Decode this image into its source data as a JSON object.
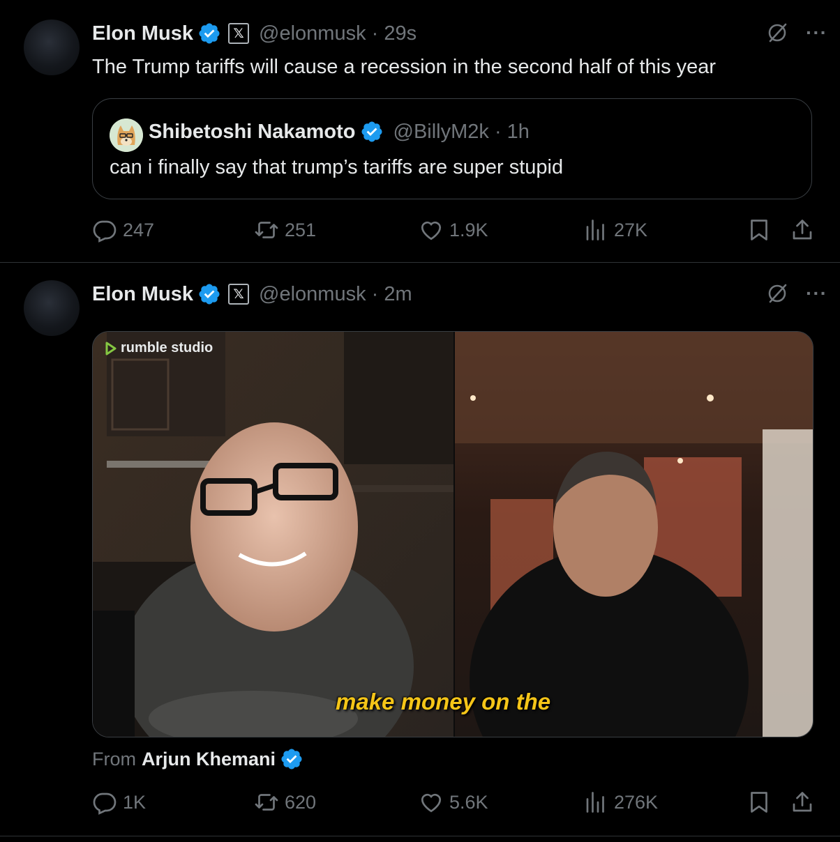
{
  "tweets": [
    {
      "author": "Elon Musk",
      "handle_time": "@elonmusk · 29s",
      "badge": "𝕏",
      "text": "The Trump tariffs will cause a recession in the second half of this year",
      "quote": {
        "author": "Shibetoshi Nakamoto",
        "handle_time": "@BillyM2k · 1h",
        "text": "can i finally say that trump’s tariffs are super stupid"
      },
      "replies": "247",
      "reposts": "251",
      "likes": "1.9K",
      "views": "27K"
    },
    {
      "author": "Elon Musk",
      "handle_time": "@elonmusk · 2m",
      "badge": "𝕏",
      "media": {
        "watermark": "rumble studio",
        "caption": "make money on the"
      },
      "from_label": "From",
      "from_name": "Arjun Khemani",
      "replies": "1K",
      "reposts": "620",
      "likes": "5.6K",
      "views": "276K"
    }
  ],
  "colors": {
    "background": "#000000",
    "text": "#e7e9ea",
    "muted": "#71767b",
    "verified": "#1d9bf0",
    "caption": "#f5c518"
  },
  "more_glyph": "···"
}
